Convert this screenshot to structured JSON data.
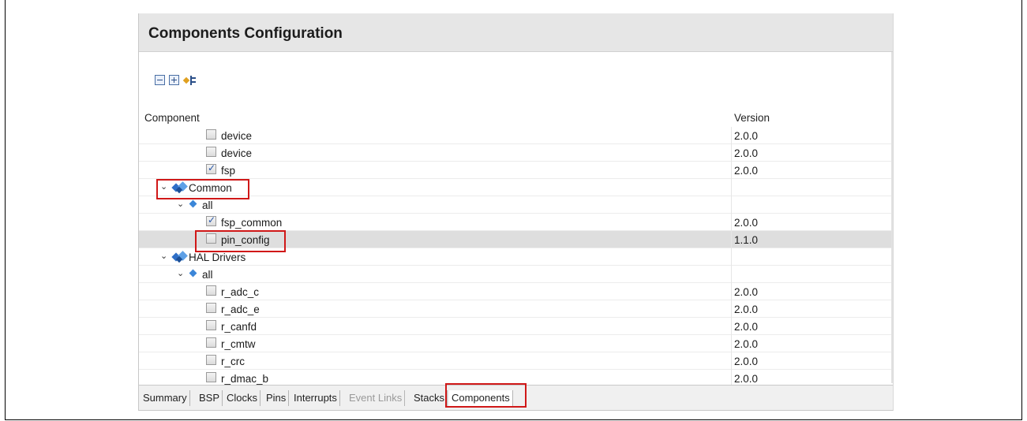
{
  "panel": {
    "title": "Components Configuration"
  },
  "toolbar": {
    "icons": [
      "collapse-all-icon",
      "expand-all-icon",
      "filter-tree-icon"
    ]
  },
  "columns": {
    "component": "Component",
    "version": "Version"
  },
  "rows": [
    {
      "label": "device",
      "version": "2.0.0",
      "kind": "checkbox",
      "checked": false
    },
    {
      "label": "device",
      "version": "2.0.0",
      "kind": "checkbox",
      "checked": false
    },
    {
      "label": "fsp",
      "version": "2.0.0",
      "kind": "checkbox",
      "checked": true
    },
    {
      "label": "Common",
      "version": "",
      "kind": "group"
    },
    {
      "label": "all",
      "version": "",
      "kind": "subgroup"
    },
    {
      "label": "fsp_common",
      "version": "2.0.0",
      "kind": "checkbox",
      "checked": true
    },
    {
      "label": "pin_config",
      "version": "1.1.0",
      "kind": "checkbox",
      "checked": false
    },
    {
      "label": "HAL Drivers",
      "version": "",
      "kind": "group"
    },
    {
      "label": "all",
      "version": "",
      "kind": "subgroup"
    },
    {
      "label": "r_adc_c",
      "version": "2.0.0",
      "kind": "checkbox",
      "checked": false
    },
    {
      "label": "r_adc_e",
      "version": "2.0.0",
      "kind": "checkbox",
      "checked": false
    },
    {
      "label": "r_canfd",
      "version": "2.0.0",
      "kind": "checkbox",
      "checked": false
    },
    {
      "label": "r_cmtw",
      "version": "2.0.0",
      "kind": "checkbox",
      "checked": false
    },
    {
      "label": "r_crc",
      "version": "2.0.0",
      "kind": "checkbox",
      "checked": false
    },
    {
      "label": "r_dmac_b",
      "version": "2.0.0",
      "kind": "checkbox",
      "checked": false
    }
  ],
  "tabs": [
    {
      "label": "Summary",
      "state": "normal"
    },
    {
      "label": "BSP",
      "state": "normal"
    },
    {
      "label": "Clocks",
      "state": "normal"
    },
    {
      "label": "Pins",
      "state": "normal"
    },
    {
      "label": "Interrupts",
      "state": "normal"
    },
    {
      "label": "Event Links",
      "state": "disabled"
    },
    {
      "label": "Stacks",
      "state": "normal"
    },
    {
      "label": "Components",
      "state": "active"
    }
  ],
  "colors": {
    "highlight": "#d01818",
    "header_bg": "#e6e6e6",
    "selected_row": "#dedede"
  }
}
